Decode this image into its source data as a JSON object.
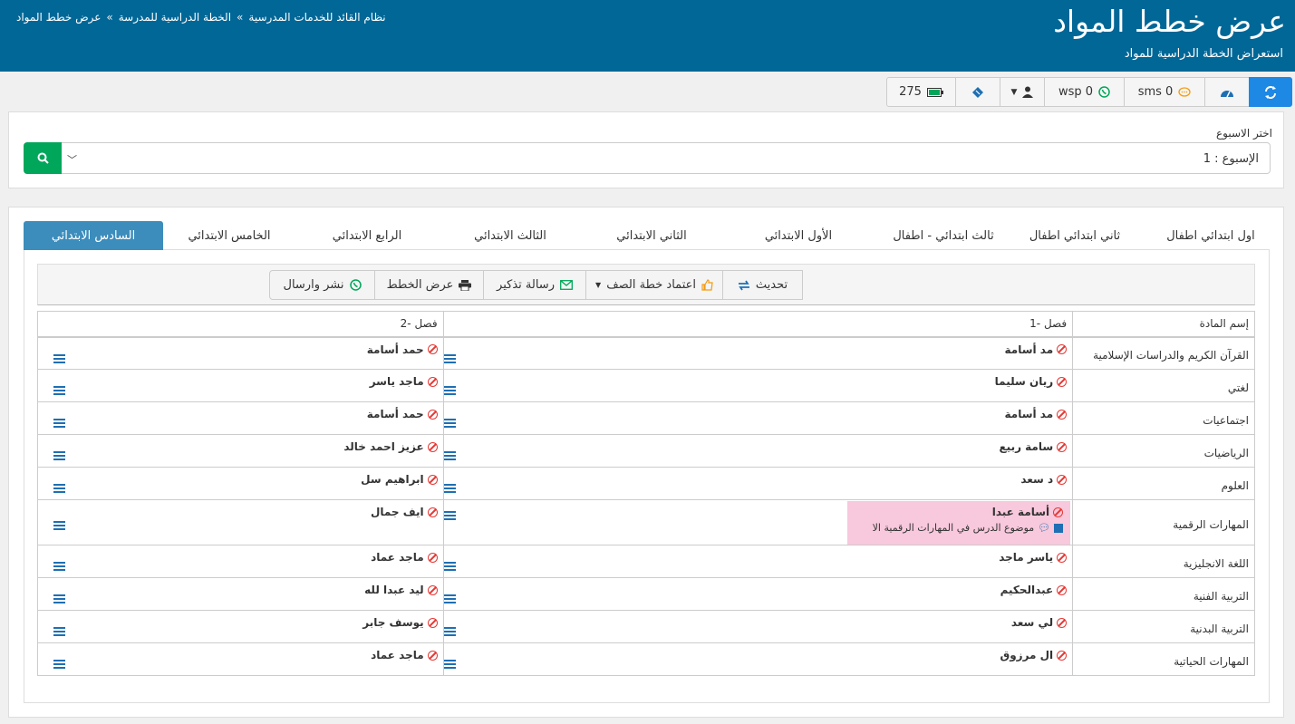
{
  "header": {
    "title": "عرض خطط المواد",
    "subtitle": "استعراض الخطة الدراسية للمواد",
    "breadcrumb": [
      "نظام القائد للخدمات المدرسية",
      "الخطة الدراسية للمدرسة",
      "عرض خطط المواد"
    ],
    "sep": "»"
  },
  "topbar": {
    "sms_label": "sms 0",
    "wsp_label": "wsp 0",
    "battery_value": "275"
  },
  "week": {
    "label": "اختر الاسبوع",
    "selected": "الإسبوع : 1"
  },
  "tabs": [
    {
      "label": "اول ابتدائي  اطفال"
    },
    {
      "label": "ثاني ابتدائي اطفال"
    },
    {
      "label": "ثالث ابتدائي - اطفال"
    },
    {
      "label": "الأول الابتدائي"
    },
    {
      "label": "الثاني الابتدائي"
    },
    {
      "label": "الثالث الابتدائي"
    },
    {
      "label": "الرابع الابتدائي"
    },
    {
      "label": "الخامس الابتدائي"
    },
    {
      "label": "السادس الابتدائي"
    }
  ],
  "actions": {
    "refresh": "تحديث",
    "approve": "اعتماد خطة الصف",
    "reminder": "رسالة تذكير",
    "view_plans": "عرض الخطط",
    "publish": "نشر وارسال"
  },
  "table": {
    "headers": {
      "subject": "إسم المادة",
      "class1": "فصل -1",
      "class2": "فصل -2"
    },
    "rows": [
      {
        "subject": "القرآن الكريم والدراسات الإسلامية",
        "t1": "مد أسامة",
        "t2": "حمد أسامة"
      },
      {
        "subject": "لغتي",
        "t1": "ريان سليما",
        "t2": "ماجد ياسر"
      },
      {
        "subject": "اجتماعيات",
        "t1": "مد أسامة",
        "t2": "حمد أسامة"
      },
      {
        "subject": "الرياضيات",
        "t1": "سامة ربيع",
        "t2": "عزيز احمد خالد"
      },
      {
        "subject": "العلوم",
        "t1": "د سعد",
        "t2": "ابراهيم سل"
      },
      {
        "subject": "المهارات الرقمية",
        "t1": "أسامة عبدا",
        "t2": "ايف جمال",
        "note": "موضوع الدرس في المهارات الرقمية الا"
      },
      {
        "subject": "اللغة الانجليزية",
        "t1": "ياسر ماجد",
        "t2": "ماجد عماد"
      },
      {
        "subject": "التربية الفنية",
        "t1": "عبدالحكيم",
        "t2": "ليد عبدا لله"
      },
      {
        "subject": "التربية البدنية",
        "t1": "لي سعد",
        "t2": "يوسف جابر"
      },
      {
        "subject": "المهارات الحياتية",
        "t1": "ال مرزوق",
        "t2": "ماجد عماد"
      }
    ]
  },
  "colors": {
    "header": "#016797",
    "primary": "#1e88e5",
    "success": "#00a65a",
    "tab_active": "#3c8dbc",
    "highlight": "#f8c8dc"
  }
}
